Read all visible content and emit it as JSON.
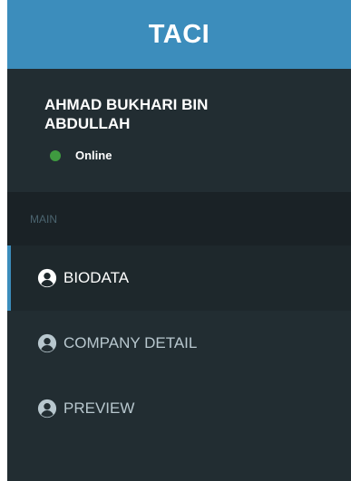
{
  "brand": {
    "title": "TACI"
  },
  "user": {
    "name": "AHMAD BUKHARI BIN ABDULLAH",
    "status": "Online",
    "status_color": "#3f9b40"
  },
  "menu": {
    "header": "MAIN",
    "items": [
      {
        "label": "BIODATA",
        "icon": "user-circle-icon",
        "active": true
      },
      {
        "label": "COMPANY DETAIL",
        "icon": "user-circle-icon",
        "active": false
      },
      {
        "label": "PREVIEW",
        "icon": "user-circle-icon",
        "active": false
      }
    ]
  },
  "colors": {
    "brand": "#3c8dbc",
    "sidebar": "#222d32"
  }
}
